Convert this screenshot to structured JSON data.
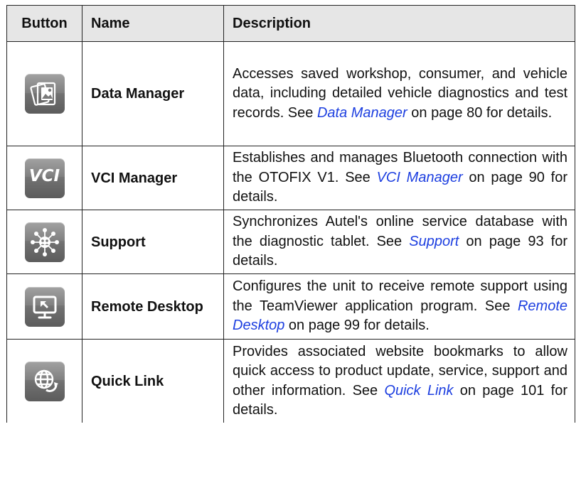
{
  "table": {
    "headers": {
      "button": "Button",
      "name": "Name",
      "description": "Description"
    },
    "rows": [
      {
        "icon": "data-manager-icon",
        "name": "Data Manager",
        "desc_before": "Accesses saved workshop, consumer, and vehicle data, including detailed vehicle diagnostics and test records. See ",
        "link": "Data Manager",
        "desc_after": " on page 80 for details."
      },
      {
        "icon": "vci-manager-icon",
        "icon_text": "VCI",
        "name": "VCI Manager",
        "desc_before": "Establishes and manages Bluetooth connection with the OTOFIX V1. See ",
        "link": "VCI Manager",
        "desc_after": " on page 90 for details."
      },
      {
        "icon": "support-icon",
        "name": "Support",
        "desc_before": "Synchronizes Autel's online service database with the diagnostic tablet. See ",
        "link": "Support",
        "desc_after": " on page 93 for details."
      },
      {
        "icon": "remote-desktop-icon",
        "name": "Remote Desktop",
        "desc_before": "Configures the unit to receive remote support using the TeamViewer application program. See ",
        "link": "Remote Desktop",
        "desc_after": " on page 99 for details."
      },
      {
        "icon": "quick-link-icon",
        "name": "Quick Link",
        "desc_before": "Provides associated website bookmarks to allow quick access to product update, service, support and other information. See ",
        "link": "Quick Link",
        "desc_after": " on page 101 for details."
      }
    ]
  },
  "colors": {
    "header_bg": "#e6e6e6",
    "link": "#1d3fe0",
    "icon_bg": "#777777"
  }
}
